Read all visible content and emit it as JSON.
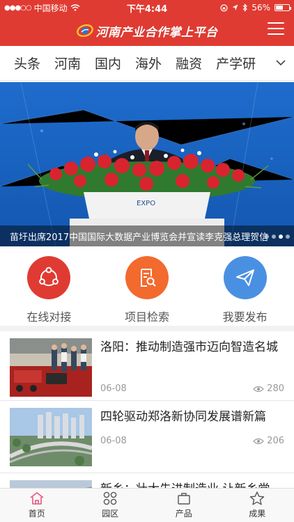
{
  "status": {
    "carrier": "中国移动",
    "time": "下午4:44",
    "battery": "56%",
    "battery_level": 0.56
  },
  "header": {
    "title": "河南产业合作掌上平台"
  },
  "tabs": [
    "头条",
    "河南",
    "国内",
    "海外",
    "融资",
    "产学研"
  ],
  "banner": {
    "caption": "苗圩出席2017中国国际大数据产业博览会并宣读李克强总理贺信",
    "podium_text": "EXPO",
    "slide_count": 4,
    "active_slide": 2
  },
  "actions": [
    {
      "label": "在线对接",
      "color": "#e03b32",
      "icon": "share-icon"
    },
    {
      "label": "项目检索",
      "color": "#f26a2e",
      "icon": "document-search-icon"
    },
    {
      "label": "我要发布",
      "color": "#4a90e2",
      "icon": "paper-plane-icon"
    }
  ],
  "news": [
    {
      "title": "洛阳：推动制造强市迈向智造名城",
      "date": "06-08",
      "views": "280"
    },
    {
      "title": "四轮驱动郑洛新协同发展谱新篇",
      "date": "06-08",
      "views": "206"
    },
    {
      "title": "新乡：壮大先进制造业 让新乡党",
      "date": "",
      "views": ""
    }
  ],
  "tabbar": [
    {
      "label": "首页",
      "icon": "home-icon",
      "active": true
    },
    {
      "label": "园区",
      "icon": "grid-icon",
      "active": false
    },
    {
      "label": "产品",
      "icon": "bag-icon",
      "active": false
    },
    {
      "label": "成果",
      "icon": "star-icon",
      "active": false
    }
  ],
  "colors": {
    "brand": "#e03b32",
    "accent_orange": "#f26a2e",
    "accent_blue": "#4a90e2",
    "active_tab": "#e8567f"
  }
}
